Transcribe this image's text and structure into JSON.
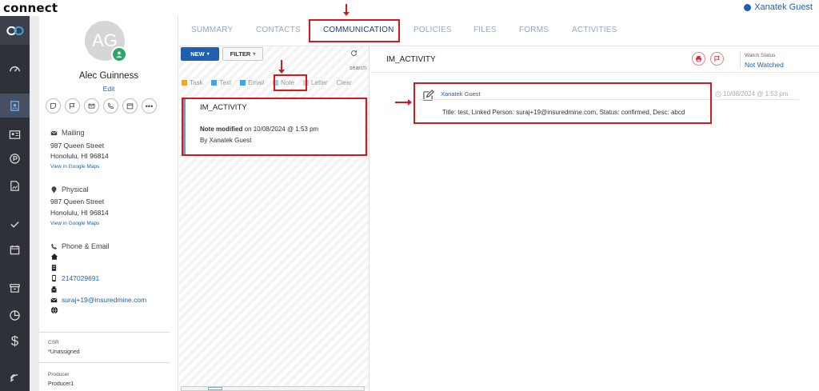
{
  "app": {
    "brand": "connect",
    "user_name": "Xanatek Guest"
  },
  "rail": {
    "icons": [
      "connect-logo-icon",
      "dashboard-gauge-icon",
      "contacts-card-icon",
      "id-card-icon",
      "policy-p-icon",
      "image-file-icon",
      "check-icon",
      "calendar-icon",
      "archive-icon",
      "pie-chart-icon",
      "dollar-icon",
      "signal-icon"
    ]
  },
  "profile": {
    "initials": "AG",
    "name": "Alec Guinness",
    "edit_label": "Edit",
    "mailing": {
      "label": "Mailing",
      "street": "987 Queen Street",
      "city": "Honolulu, HI 96814",
      "map_link": "View in Google Maps"
    },
    "physical": {
      "label": "Physical",
      "street": "987 Queen Street",
      "city": "Honolulu, HI 96814",
      "map_link": "View in Google Maps"
    },
    "contact": {
      "label": "Phone & Email",
      "phone": "2147029691",
      "email": "suraj+19@insuredmine.com"
    },
    "csr": {
      "label": "CSR",
      "value": "*Unassigned"
    },
    "producer": {
      "label": "Producer",
      "value": "Producer1"
    }
  },
  "tabs": [
    "SUMMARY",
    "CONTACTS",
    "COMMUNICATION",
    "POLICIES",
    "FILES",
    "FORMS",
    "ACTIVITIES"
  ],
  "active_tab": "COMMUNICATION",
  "list": {
    "new_label": "NEW",
    "filter_label": "FILTER",
    "search_placeholder": "search",
    "filters": [
      {
        "label": "Task",
        "color": "#f5a623"
      },
      {
        "label": "Text",
        "color": "#4aa3df"
      },
      {
        "label": "Email",
        "color": "#4aa3df"
      },
      {
        "label": "Note",
        "color": "#a9cbe8"
      },
      {
        "label": "Letter",
        "color": "#cfcfcf"
      }
    ],
    "clear_label": "Clear",
    "item": {
      "title": "IM_ACTIVITY",
      "action": "Note modified",
      "when": "on 10/08/2024 @ 1:53 pm",
      "by": "By Xanatek Guest"
    }
  },
  "detail": {
    "title": "IM_ACTIVITY",
    "watch_label": "Watch Status",
    "watch_value": "Not Watched",
    "entry": {
      "author": "Xanatek Guest",
      "time": "10/08/2024 @ 1:53 pm",
      "description": "Title: test, Linked Person: suraj+19@insuredmine.com, Status: confirmed, Desc: abcd"
    }
  },
  "colors": {
    "primary": "#1f5fae",
    "rail": "#2f3138",
    "annotation": "#d9161b",
    "badge": "#2fa56a"
  }
}
